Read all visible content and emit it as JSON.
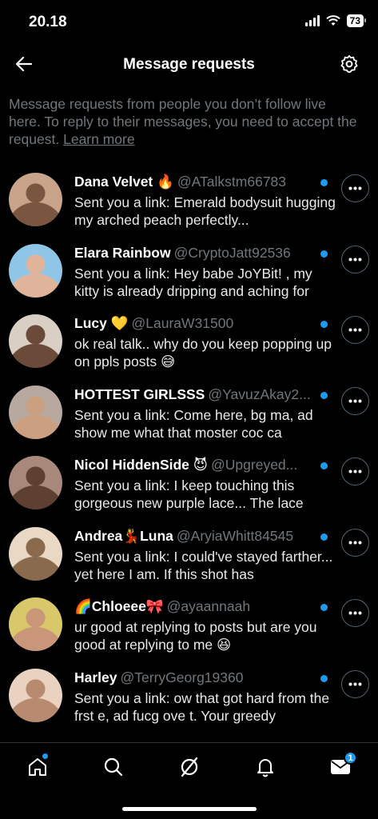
{
  "status_bar": {
    "time": "20.18",
    "battery": "73"
  },
  "header": {
    "title": "Message requests",
    "back_icon": "arrow-left-icon",
    "settings_icon": "gear-icon"
  },
  "intro": {
    "text": "Message requests from people you don’t follow live here. To reply to their messages, you need to accept the request.",
    "link": "Learn more"
  },
  "requests": [
    {
      "name": "Dana Velvet 🔥",
      "handle": "@ATalkstm66783",
      "preview": "Sent you a link: Emerald bodysuit hugging my arched peach perfectly...",
      "unread": true,
      "avatar_colors": [
        "#c9a48a",
        "#7a5540"
      ]
    },
    {
      "name": "Elara Rainbow",
      "handle": "@CryptoJatt92536",
      "preview": "Sent you a link: Hey babe JoYBit!  , my kitty is already dripping and aching for",
      "unread": true,
      "avatar_colors": [
        "#8fc6e8",
        "#e0b49a"
      ]
    },
    {
      "name": "Lucy 💛",
      "handle": "@LauraW31500",
      "preview": "ok real talk.. why do you keep popping up on ppls posts 😅",
      "unread": true,
      "avatar_colors": [
        "#d9cfc4",
        "#6b4a3a"
      ]
    },
    {
      "name": "HOTTEST GIRLSSS",
      "handle": "@YavuzAkay2...",
      "preview": "Sent you a link: Come here, bg ma, ad show me what that moster coc ca",
      "unread": true,
      "avatar_colors": [
        "#b8a9a0",
        "#caa080"
      ]
    },
    {
      "name": "Nicol HiddenSide 😈",
      "handle": "@Upgreyed...",
      "preview": "Sent you a link: I keep touching this gorgeous new purple lace... The lace",
      "unread": true,
      "avatar_colors": [
        "#a8887a",
        "#5e4033"
      ]
    },
    {
      "name": "Andrea💃Luna",
      "handle": "@AryiaWhitt84545",
      "preview": "Sent you a link: I could've stayed farther... yet here I am. If this shot has",
      "unread": true,
      "avatar_colors": [
        "#e8d8c4",
        "#8a6a4c"
      ]
    },
    {
      "name": "🌈Chloeee🎀",
      "handle": "@ayaannaah",
      "preview": "ur good at replying to posts but are you good at replying to me 😆",
      "unread": true,
      "avatar_colors": [
        "#d9c86a",
        "#c9967a"
      ]
    },
    {
      "name": "Harley",
      "handle": "@TerryGeorg19360",
      "preview": "Sent you a link: ow that got hard from the frst e, ad  fucg ove t. Your greedy",
      "unread": true,
      "avatar_colors": [
        "#e9d2c0",
        "#b88a70"
      ]
    }
  ],
  "more_icon": "more-horizontal-icon",
  "tab_bar": {
    "tabs": [
      {
        "name": "home",
        "icon": "home-icon"
      },
      {
        "name": "search",
        "icon": "search-icon"
      },
      {
        "name": "grok",
        "icon": "grok-icon"
      },
      {
        "name": "notifications",
        "icon": "bell-icon"
      },
      {
        "name": "messages",
        "icon": "envelope-icon",
        "badge": "1"
      }
    ]
  },
  "colors": {
    "accent": "#1d9bf0",
    "muted": "#71767b",
    "background": "#000000"
  }
}
